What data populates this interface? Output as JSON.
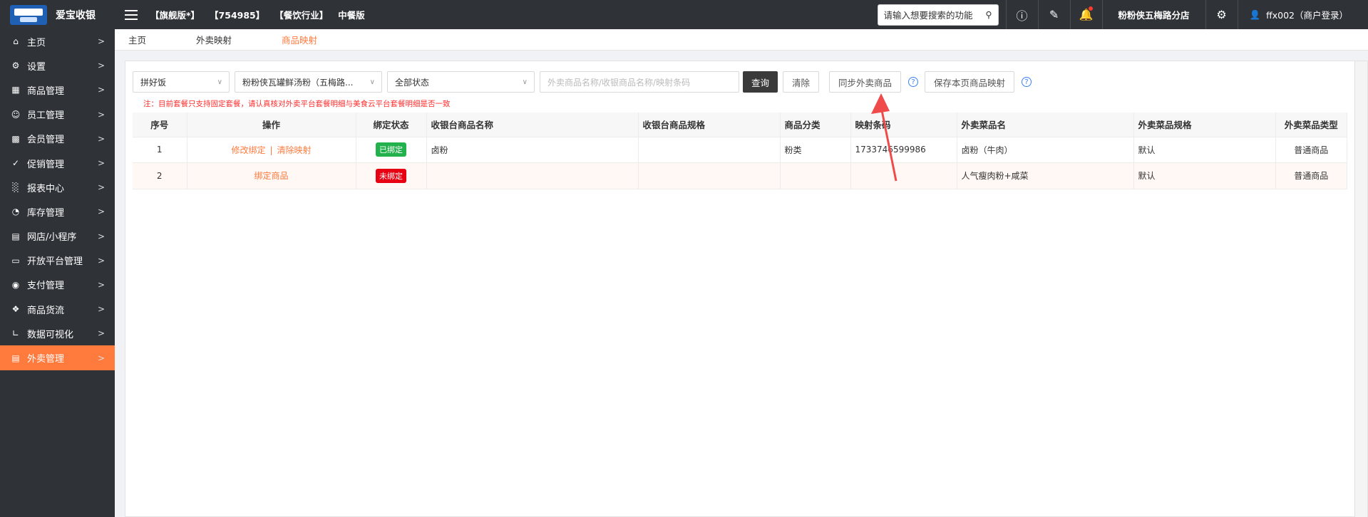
{
  "app": {
    "brand": "爱宝收银",
    "tags": [
      "【旗舰版*】",
      "【754985】",
      "【餐饮行业】",
      "中餐版"
    ]
  },
  "topbar": {
    "search_placeholder": "请输入想要搜索的功能",
    "store": "粉粉侠五梅路分店",
    "user": "ffx002（商户登录）",
    "icons": [
      "help-icon",
      "edit-icon",
      "bell-icon",
      "gear-icon",
      "user-icon"
    ]
  },
  "sidebar": {
    "items": [
      {
        "label": "主页",
        "icon": "home-icon"
      },
      {
        "label": "设置",
        "icon": "settings-icon"
      },
      {
        "label": "商品管理",
        "icon": "goods-icon"
      },
      {
        "label": "员工管理",
        "icon": "staff-icon"
      },
      {
        "label": "会员管理",
        "icon": "member-icon"
      },
      {
        "label": "促销管理",
        "icon": "promo-icon"
      },
      {
        "label": "报表中心",
        "icon": "report-icon"
      },
      {
        "label": "库存管理",
        "icon": "inventory-icon"
      },
      {
        "label": "网店/小程序",
        "icon": "shop-icon"
      },
      {
        "label": "开放平台管理",
        "icon": "platform-icon"
      },
      {
        "label": "支付管理",
        "icon": "pay-icon"
      },
      {
        "label": "商品货流",
        "icon": "flow-icon"
      },
      {
        "label": "数据可视化",
        "icon": "chart-icon"
      },
      {
        "label": "外卖管理",
        "icon": "takeout-icon"
      }
    ],
    "active": "外卖管理"
  },
  "tabs": [
    "主页",
    "外卖映射",
    "商品映射"
  ],
  "active_tab": "商品映射",
  "filters": {
    "platform": "拼好饭",
    "store": "粉粉侠瓦罐鲜汤粉（五梅路...",
    "status": "全部状态",
    "search_placeholder": "外卖商品名称/收银商品名称/映射条码",
    "query": "查询",
    "clear": "清除",
    "sync": "同步外卖商品",
    "save": "保存本页商品映射"
  },
  "note": "注：目前套餐只支持固定套餐，请认真核对外卖平台套餐明细与美食云平台套餐明细是否一致",
  "table": {
    "headers": [
      "序号",
      "操作",
      "绑定状态",
      "收银台商品名称",
      "收银台商品规格",
      "商品分类",
      "映射条码",
      "外卖菜品名",
      "外卖菜品规格",
      "外卖菜品类型"
    ],
    "rows": [
      {
        "no": "1",
        "op1": "修改绑定",
        "op2": "清除映射",
        "status": "已绑定",
        "name": "卤粉",
        "spec": "",
        "cat": "粉类",
        "code": "1733746599986",
        "takeout_name": "卤粉（牛肉）",
        "takeout_spec": "默认",
        "type": "普通商品"
      },
      {
        "no": "2",
        "op1": "绑定商品",
        "op2": "",
        "status": "未绑定",
        "name": "",
        "spec": "",
        "cat": "",
        "code": "",
        "takeout_name": "人气瘦肉粉+咸菜",
        "takeout_spec": "默认",
        "type": "普通商品"
      }
    ]
  },
  "colors": {
    "accent": "#ff7a3d",
    "topbar": "#2f3237",
    "bound": "#22b14c",
    "unbound": "#e60012",
    "arrow": "#ef4b4b"
  }
}
